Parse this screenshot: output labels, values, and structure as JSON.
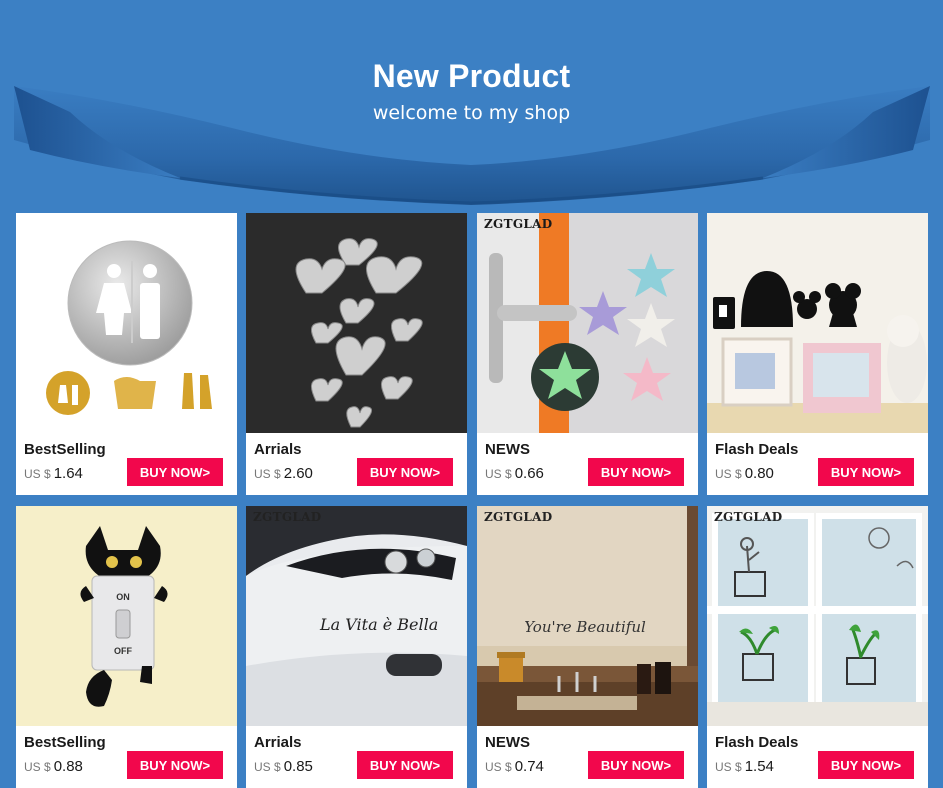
{
  "header": {
    "title": "New Product",
    "subtitle": "welcome to my shop"
  },
  "products": [
    {
      "category": "BestSelling",
      "currency": "US $",
      "price": "1.64",
      "buy_label": "BUY NOW>",
      "brand": "",
      "image": "toilet-sign-mirror-stickers"
    },
    {
      "category": "Arrials",
      "currency": "US $",
      "price": "2.60",
      "buy_label": "BUY NOW>",
      "brand": "",
      "image": "mirror-hearts-wall-stickers"
    },
    {
      "category": "NEWS",
      "currency": "US $",
      "price": "0.66",
      "buy_label": "BUY NOW>",
      "brand": "ZGTGLAD",
      "image": "starfish-door-stoppers"
    },
    {
      "category": "Flash Deals",
      "currency": "US $",
      "price": "0.80",
      "buy_label": "BUY NOW>",
      "brand": "",
      "image": "mouse-hole-wall-decal"
    },
    {
      "category": "BestSelling",
      "currency": "US $",
      "price": "0.88",
      "buy_label": "BUY NOW>",
      "brand": "",
      "image": "cat-light-switch-sticker"
    },
    {
      "category": "Arrials",
      "currency": "US $",
      "price": "0.85",
      "buy_label": "BUY NOW>",
      "brand": "ZGTGLAD",
      "image": "car-decal-la-vita-e-bella"
    },
    {
      "category": "NEWS",
      "currency": "US $",
      "price": "0.74",
      "buy_label": "BUY NOW>",
      "brand": "ZGTGLAD",
      "image": "mirror-decal-youre-beautiful"
    },
    {
      "category": "Flash Deals",
      "currency": "US $",
      "price": "1.54",
      "buy_label": "BUY NOW>",
      "brand": "ZGTGLAD",
      "image": "window-plant-pot-decals"
    }
  ],
  "decals": {
    "car_text": "La Vita è Bella",
    "mirror_text": "You're Beautiful",
    "switch_on": "ON",
    "switch_off": "OFF"
  },
  "colors": {
    "background": "#3c80c4",
    "buy_button": "#f2074c"
  }
}
